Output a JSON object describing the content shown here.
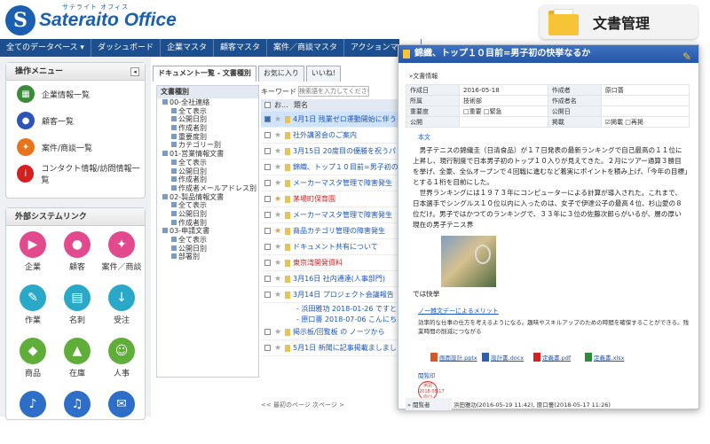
{
  "logo": {
    "mark": "S",
    "sub": "サテライト オフィス",
    "name": "Sateraito Office"
  },
  "badge": {
    "title": "文書管理"
  },
  "nav": [
    "全てのデータベース ▾",
    "ダッシュボード",
    "企業マスタ",
    "顧客マスタ",
    "案件／商談マスタ",
    "アクションマスタ"
  ],
  "ops": {
    "title": "操作メニュー",
    "items": [
      "企業情報一覧",
      "顧客一覧",
      "案件/商談一覧",
      "コンタクト情報/訪問情報一覧"
    ]
  },
  "ext": {
    "title": "外部システムリンク",
    "items": [
      "企業",
      "顧客",
      "案件／商談",
      "作業",
      "名刺",
      "受注",
      "商品",
      "在庫",
      "人事"
    ]
  },
  "tabs": [
    "ドキュメント一覧 - 文書種別",
    "お気に入り",
    "いいね!"
  ],
  "tree": {
    "header": "文書種別",
    "nodes": [
      "00-全社連絡",
      "全て表示",
      "公開日別",
      "作成者別",
      "重要度別",
      "カテゴリー別",
      "01-営業情報文書",
      "全て表示",
      "公開日別",
      "作成者別",
      "作成者メールアドレス別",
      "02-製品情報文書",
      "全て表示",
      "公開日別",
      "作成者別",
      "03-申請文書",
      "全て表示",
      "公開日別",
      "部署別"
    ]
  },
  "list": {
    "keyword_label": "キーワード",
    "placeholder": "検索語を入力してください",
    "col_o": "お...",
    "col_title": "題名",
    "rows": [
      "4月1日 残業ゼロ運動開始に伴う",
      "社外講習会のご案内",
      "3月15日 20度目の優勝を祝うパ",
      "錦織、トップ１０目前=男子初の",
      "メーカーマスタ管理で障害発生",
      "茅場町保育園",
      "メーカーマスタ管理で障害発生",
      "商品カテゴリ管理の障害発生",
      "ドキュメント共有について",
      "東京湾開発資料",
      "3月16日 社内通達(人事部門)",
      "3月14日 プロジェクト会議報告",
      "- 浜田雅功 2018-01-26 ですと",
      "- 原口薔 2018-07-06 こんにちは",
      "掲示板/回覧板 の ノーツから",
      "5月1日 新聞に記事掲載ましまし"
    ],
    "pager": "<< 最初のページ 次ページ >"
  },
  "detail": {
    "title": "錦織、トップ１０目前=男子初の快挙なるか",
    "section": "»文書情報",
    "info": [
      [
        "作成日",
        "2016-05-18",
        "作成者",
        "原口薔"
      ],
      [
        "所属",
        "技術部",
        "作成者名",
        ""
      ],
      [
        "重要度",
        "□重要 □緊急",
        "公開日",
        ""
      ],
      [
        "公開",
        "",
        "掲載",
        "☑掲載 □再掲"
      ]
    ],
    "honbun": "本文",
    "paragraphs": [
      "男子テニスの錦織圭（日清食品）が１７日発表の最新ランキングで自己最高の１１位に上昇し、現行制度で日本男子初のトップ１０入りが見えてきた。２月にツアー通算３勝目を挙げ、全豪、全仏オープンで４回戦に進むなど着実にポイントを積み上げ、「今年の目標」とする１桁を目前にした。",
      "世界ランキングには１９７３年にコンピューターによる計算が導入された。これまで、日本選手でシングルス１０位以内に入ったのは、女子で伊達公子の最高４位、杉山愛の８位だけ。男子ではかつてのランキングで、３３年に３位の佐藤次郎らがいるが、層の厚い現在の男子テニス界"
    ],
    "caption": "では快挙",
    "link": "ノー雑文デーによるメリット",
    "small": "効率的な仕事の仕方を考えるようになる。趣味やスキルアップのための時間を確保することができる。残業時間の削減につながる",
    "files": [
      "画面設計.pptx",
      "設計書.docx",
      "定義書.pdf",
      "定義書.xlsx"
    ],
    "stamp_label": "閲覧印",
    "stamp": [
      "承認",
      "2018.05.17",
      "原口"
    ],
    "footer_k": "» 閲覧者",
    "footer_v": "浜田雅功(2016-05-19 11:42), 原口薔(2018-05-17 11:26)"
  },
  "colors": {
    "brand": "#1a5fb0",
    "nav": "#1c4f8f",
    "accent": "#f6c436"
  }
}
